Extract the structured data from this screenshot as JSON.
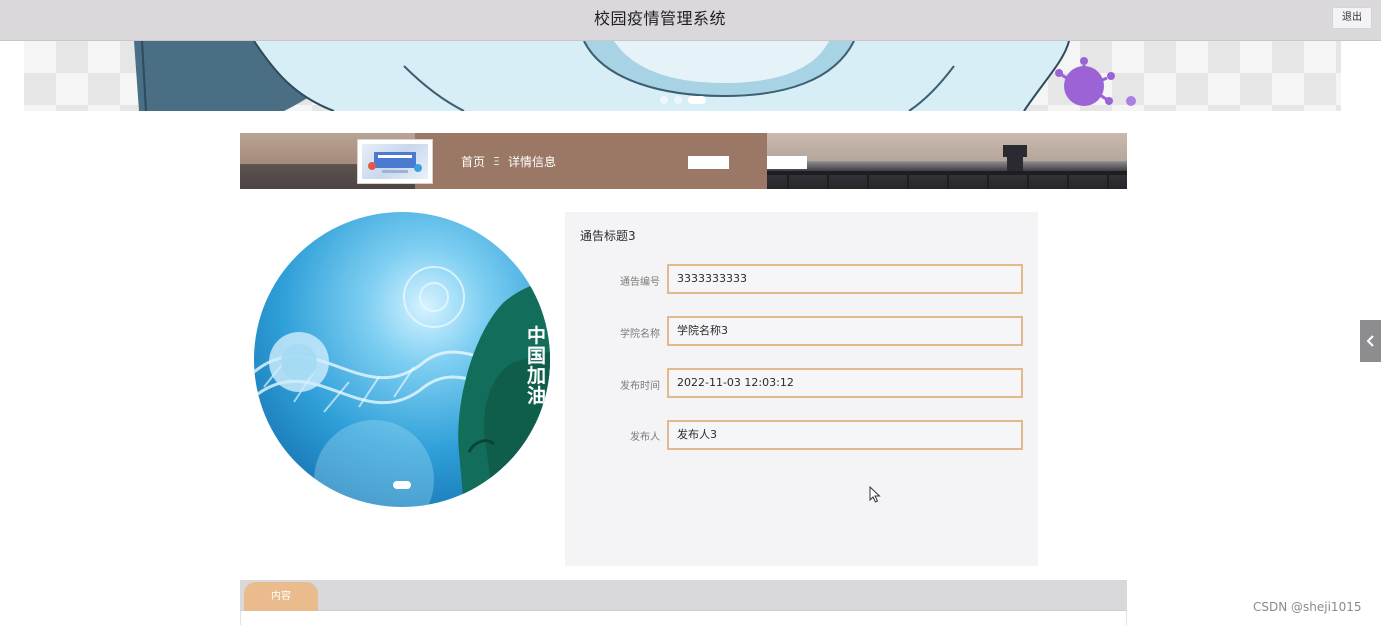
{
  "header": {
    "title": "校园疫情管理系统",
    "logout_label": "退出"
  },
  "banner": {
    "slide_count": 3,
    "active_index": 2
  },
  "breadcrumb": {
    "home": "首页",
    "separator": "Ξ",
    "current": "详情信息"
  },
  "hero": {
    "overlay_text": "中国加油",
    "slide_count": 1
  },
  "detail": {
    "title": "通告标题3",
    "fields": [
      {
        "label": "通告编号",
        "value": "3333333333"
      },
      {
        "label": "学院名称",
        "value": "学院名称3"
      },
      {
        "label": "发布时间",
        "value": "2022-11-03 12:03:12"
      },
      {
        "label": "发布人",
        "value": "发布人3"
      }
    ]
  },
  "tabs": [
    {
      "label": "内容",
      "active": true
    }
  ],
  "watermark": "CSDN @sheji1015",
  "colors": {
    "accent": "#e2b98d",
    "tab_active": "#e9bb8d",
    "header_bg": "#dad8db",
    "panel_bg": "#f4f4f6"
  }
}
